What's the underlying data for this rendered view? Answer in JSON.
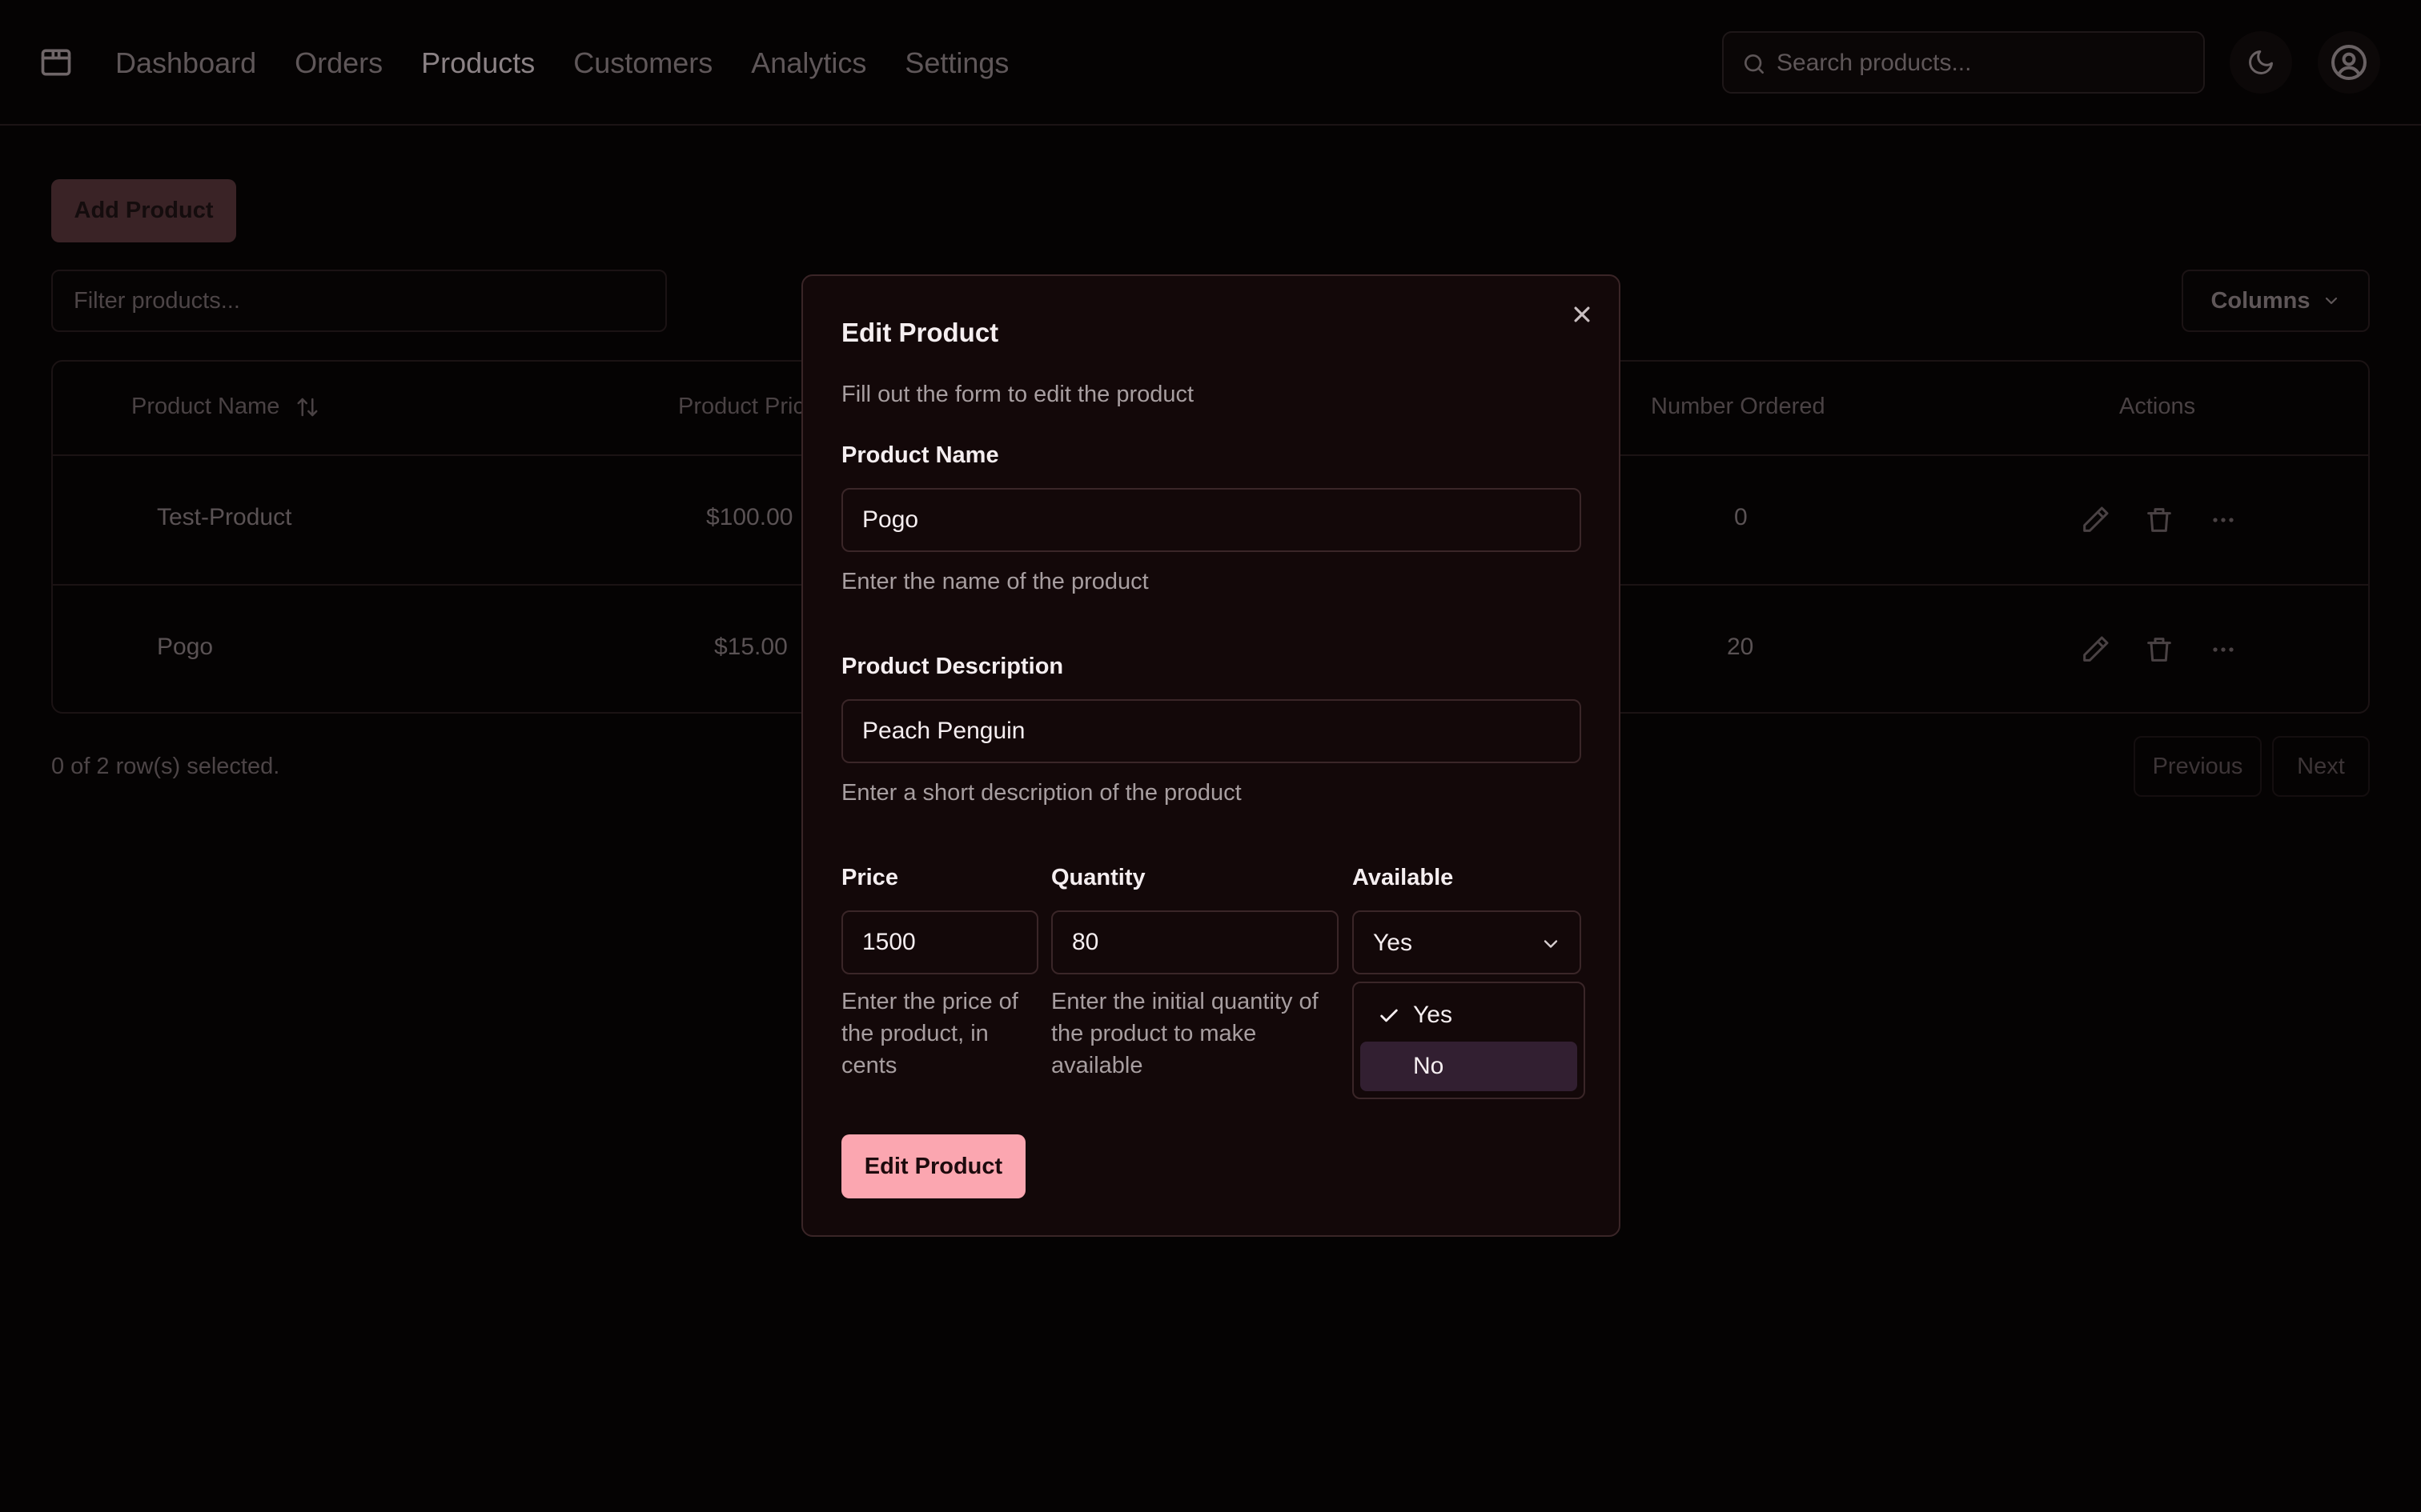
{
  "nav": {
    "brand_icon": "package-icon",
    "links": [
      "Dashboard",
      "Orders",
      "Products",
      "Customers",
      "Analytics",
      "Settings"
    ],
    "active": "Products",
    "search_placeholder": "Search products...",
    "theme_icon": "moon-icon",
    "user_icon": "user-circle-icon"
  },
  "toolbar": {
    "add_product_label": "Add Product",
    "filter_placeholder": "Filter products...",
    "columns_label": "Columns"
  },
  "table": {
    "headers": [
      "Product Name",
      "Product Pric",
      "Number Ordered",
      "Actions"
    ],
    "rows": [
      {
        "name": "Test-Product",
        "price": "$100.00",
        "ordered": "0"
      },
      {
        "name": "Pogo",
        "price": "$15.00",
        "ordered": "20"
      }
    ],
    "selected_count": "0 of 2 row(s) selected.",
    "previous_label": "Previous",
    "next_label": "Next"
  },
  "modal": {
    "title": "Edit Product",
    "subtitle": "Fill out the form to edit the product",
    "name_label": "Product Name",
    "name_value": "Pogo",
    "name_help": "Enter the name of the product",
    "description_label": "Product Description",
    "description_value": "Peach Penguin",
    "description_help": "Enter a short description of the product",
    "price_label": "Price",
    "price_value": "1500",
    "price_help": "Enter the price of the product, in cents",
    "quantity_label": "Quantity",
    "quantity_value": "80",
    "quantity_help": "Enter the initial quantity of the product to make available",
    "available_label": "Available",
    "available_value": "Yes",
    "available_options": [
      "Yes",
      "No"
    ],
    "submit_label": "Edit Product"
  },
  "colors": {
    "accent": "#fba6b0",
    "highlight": "#321f31",
    "modal_bg": "#130809"
  }
}
